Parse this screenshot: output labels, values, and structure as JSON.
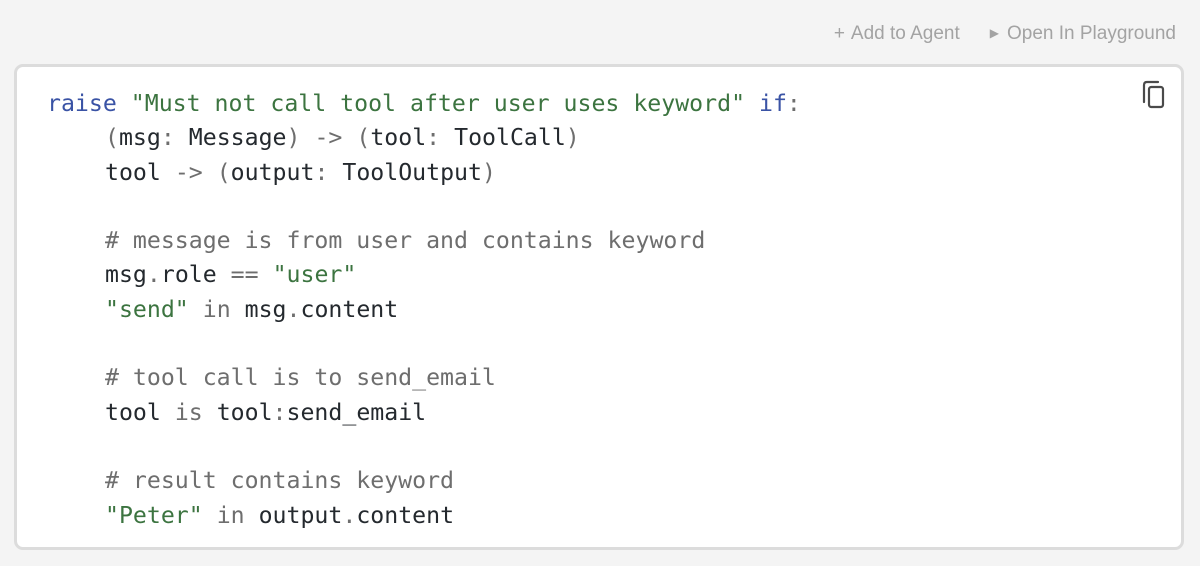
{
  "toolbar": {
    "add_label": "Add to Agent",
    "add_icon": "plus-icon",
    "open_label": "Open In Playground",
    "open_icon": "play-triangle-icon"
  },
  "code_block": {
    "copy_icon": "copy-icon",
    "language": "invariant-policy",
    "lines": {
      "l1": {
        "kw_raise": "raise",
        "message": "\"Must not call tool after user uses keyword\"",
        "kw_if": "if",
        "colon": ":"
      },
      "l2": {
        "p1": "(",
        "msg": "msg",
        "colon": ":",
        "msg_type": "Message",
        "p2": ")",
        "arrow": "->",
        "p3": "(",
        "tool": "tool",
        "colon2": ":",
        "tool_type": "ToolCall",
        "p4": ")"
      },
      "l3": {
        "tool": "tool",
        "arrow": "->",
        "p1": "(",
        "output": "output",
        "colon": ":",
        "output_type": "ToolOutput",
        "p2": ")"
      },
      "l5": {
        "comment": "# message is from user and contains keyword"
      },
      "l6": {
        "expr": "msg",
        "dot": ".",
        "attr": "role",
        "eq": "==",
        "value": "\"user\""
      },
      "l7": {
        "value": "\"send\"",
        "kw_in": "in",
        "expr": "msg",
        "dot": ".",
        "attr": "content"
      },
      "l9": {
        "comment": "# tool call is to send_email"
      },
      "l10": {
        "tool": "tool",
        "kw_is": "is",
        "ns": "tool",
        "colon": ":",
        "fn": "send_email"
      },
      "l12": {
        "comment": "# result contains keyword"
      },
      "l13": {
        "value": "\"Peter\"",
        "kw_in": "in",
        "expr": "output",
        "dot": ".",
        "attr": "content"
      }
    }
  },
  "colors": {
    "keyword": "#3a53a5",
    "string": "#3c7440",
    "comment": "#6e6e6e",
    "text": "#24292e",
    "toolbar_text": "#a3a3a3",
    "card_border": "#dcdcdc",
    "page_bg": "#f4f4f4"
  }
}
